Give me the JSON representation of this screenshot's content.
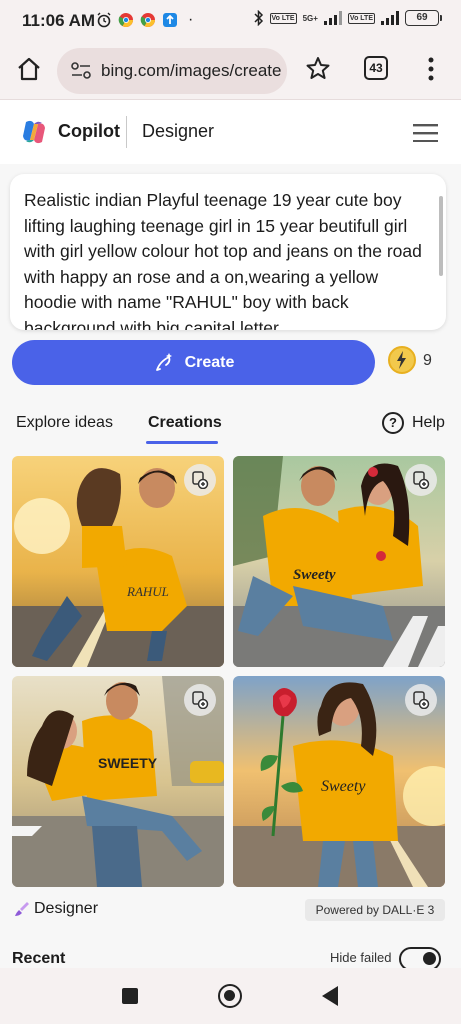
{
  "status_bar": {
    "time": "11:06 AM",
    "battery": "69",
    "network": "5G+",
    "lte_label": "Vo LTE"
  },
  "browser": {
    "url": "bing.com/images/create",
    "tab_count": "43"
  },
  "header": {
    "brand": "Copilot",
    "section": "Designer"
  },
  "prompt": {
    "text": "Realistic indian Playful teenage 19 year cute boy lifting laughing teenage girl   in  15 year beutifull girl  with girl yellow colour hot top and jeans  on the road with happy an rose and a on,wearing a yellow hoodie with name \"RAHUL\" boy  with back background with big capital letter"
  },
  "create": {
    "label": "Create",
    "boost_count": "9"
  },
  "tabs": {
    "explore": "Explore ideas",
    "creations": "Creations",
    "help": "Help"
  },
  "images": [
    {
      "hoodie_text": "RAHUL"
    },
    {
      "hoodie_text": "Sweety"
    },
    {
      "hoodie_text": "SWEETY"
    },
    {
      "hoodie_text": "Sweety"
    }
  ],
  "footer": {
    "designer": "Designer",
    "powered_by": "Powered by DALL·E 3"
  },
  "recent": {
    "label": "Recent",
    "hide_failed": "Hide failed",
    "hide_failed_on": true
  },
  "colors": {
    "accent": "#4a62e8",
    "hoodie": "#f2a900",
    "boost": "#f2c94c"
  }
}
